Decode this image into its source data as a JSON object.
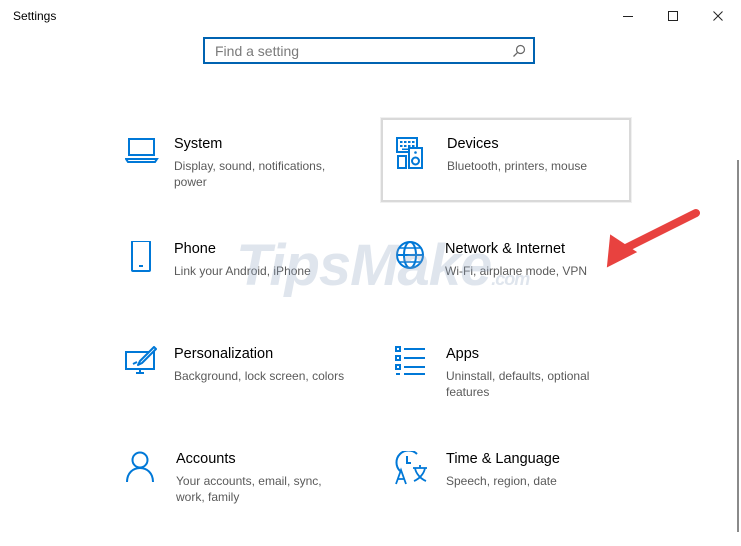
{
  "window": {
    "title": "Settings",
    "controls": [
      "minimize-icon",
      "maximize-icon",
      "close-icon"
    ]
  },
  "search": {
    "placeholder": "Find a setting",
    "value": "",
    "icon": "search-icon"
  },
  "categories": [
    {
      "name": "System",
      "desc": "Display, sound, notifications, power",
      "icon": "laptop-icon"
    },
    {
      "name": "Devices",
      "desc": "Bluetooth, printers, mouse",
      "icon": "keyboard-speaker-icon"
    },
    {
      "name": "Phone",
      "desc": "Link your Android, iPhone",
      "icon": "phone-icon"
    },
    {
      "name": "Network & Internet",
      "desc": "Wi-Fi, airplane mode, VPN",
      "icon": "globe-icon"
    },
    {
      "name": "Personalization",
      "desc": "Background, lock screen, colors",
      "icon": "paintbrush-icon"
    },
    {
      "name": "Apps",
      "desc": "Uninstall, defaults, optional features",
      "icon": "apps-list-icon"
    },
    {
      "name": "Accounts",
      "desc": "Your accounts, email, sync, work, family",
      "icon": "person-icon"
    },
    {
      "name": "Time & Language",
      "desc": "Speech, region, date",
      "icon": "time-language-icon"
    }
  ],
  "watermark": {
    "text": "TipsMake",
    "suffix": ".com"
  },
  "colors": {
    "accent": "#0063b1",
    "icon": "#0078d7",
    "annotation_arrow": "#e8423f"
  }
}
